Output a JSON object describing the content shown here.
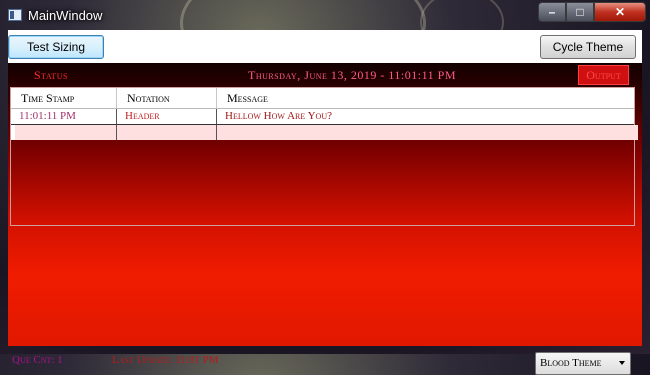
{
  "window": {
    "title": "MainWindow",
    "controls": {
      "minimize": "–",
      "maximize": "□",
      "close": "✕"
    }
  },
  "toolbar": {
    "test_sizing_label": "Test Sizing",
    "cycle_theme_label": "Cycle Theme"
  },
  "status": {
    "label": "Status",
    "datetime": "Thursday, June 13, 2019 - 11:01:11 PM",
    "output_label": "Output"
  },
  "grid": {
    "columns": [
      "Time Stamp",
      "Notation",
      "Message"
    ],
    "rows": [
      {
        "time_stamp": "11:01:11 PM",
        "notation": "Header",
        "message": "Hellow How Are You?"
      }
    ]
  },
  "footer": {
    "que_count": "Que Cnt: 1",
    "last_update": "Last Update: 11:01 PM",
    "theme_select_value": "Blood Theme"
  },
  "colors": {
    "accent": "#f01c00",
    "status_text": "#ff2a2a",
    "datetime_text": "#ff5a8a"
  }
}
